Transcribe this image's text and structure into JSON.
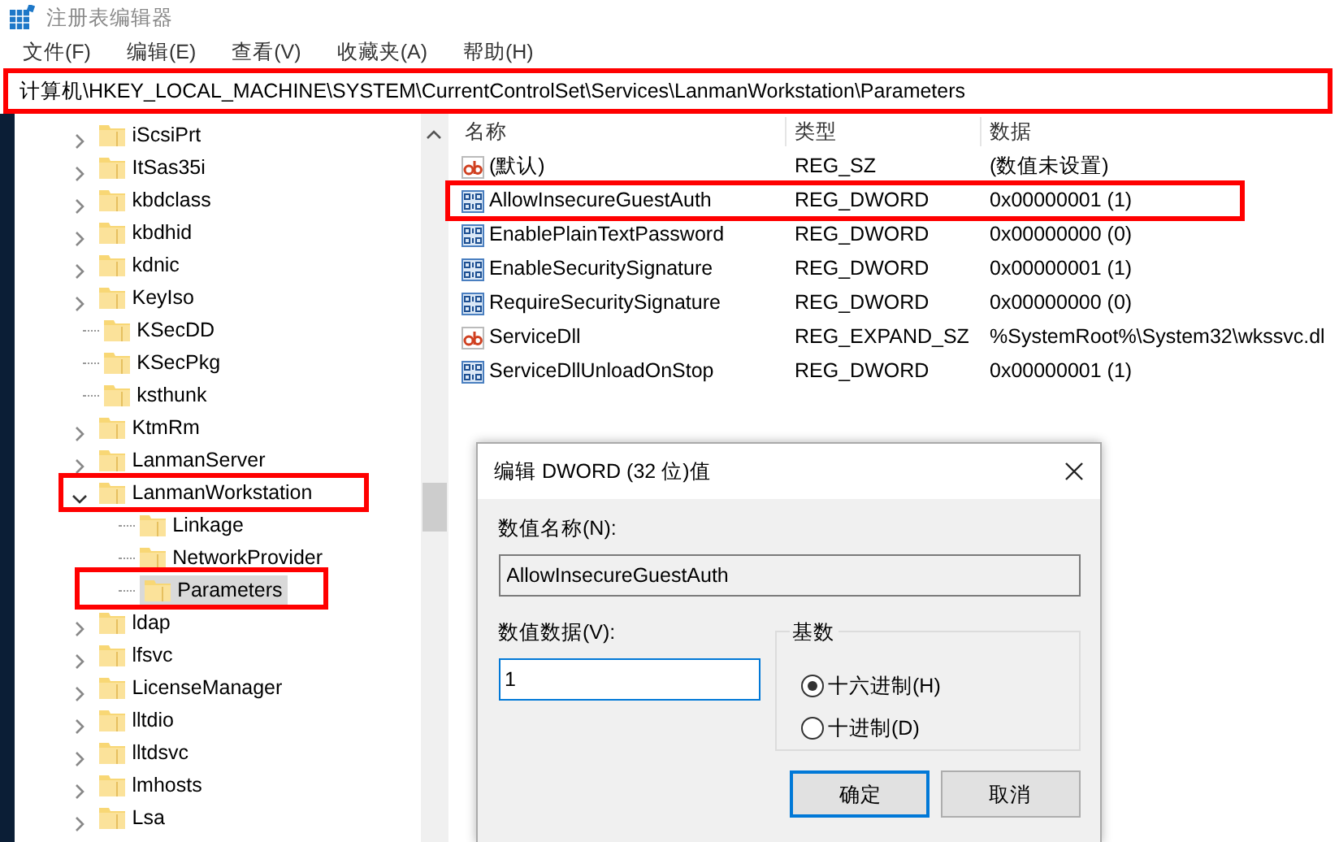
{
  "window": {
    "title": "注册表编辑器"
  },
  "menu": [
    "文件(F)",
    "编辑(E)",
    "查看(V)",
    "收藏夹(A)",
    "帮助(H)"
  ],
  "address_bar": {
    "path": "计算机\\HKEY_LOCAL_MACHINE\\SYSTEM\\CurrentControlSet\\Services\\LanmanWorkstation\\Parameters",
    "highlighted": true
  },
  "tree": [
    {
      "label": "iScsiPrt",
      "expanded": false,
      "selected": false,
      "highlighted": false
    },
    {
      "label": "ItSas35i",
      "expanded": false,
      "selected": false,
      "highlighted": false
    },
    {
      "label": "kbdclass",
      "expanded": false,
      "selected": false,
      "highlighted": false
    },
    {
      "label": "kbdhid",
      "expanded": false,
      "selected": false,
      "highlighted": false
    },
    {
      "label": "kdnic",
      "expanded": false,
      "selected": false,
      "highlighted": false
    },
    {
      "label": "KeyIso",
      "expanded": false,
      "selected": false,
      "highlighted": false
    },
    {
      "label": "KSecDD",
      "selected": false,
      "highlighted": false
    },
    {
      "label": "KSecPkg",
      "selected": false,
      "highlighted": false
    },
    {
      "label": "ksthunk",
      "selected": false,
      "highlighted": false
    },
    {
      "label": "KtmRm",
      "expanded": false,
      "selected": false,
      "highlighted": false
    },
    {
      "label": "LanmanServer",
      "expanded": false,
      "selected": false,
      "highlighted": false
    },
    {
      "label": "LanmanWorkstation",
      "expanded": true,
      "selected": false,
      "highlighted": true,
      "children": [
        {
          "label": "Linkage",
          "selected": false,
          "highlighted": false
        },
        {
          "label": "NetworkProvider",
          "selected": false,
          "highlighted": false
        },
        {
          "label": "Parameters",
          "selected": true,
          "highlighted": true
        }
      ]
    },
    {
      "label": "ldap",
      "expanded": false,
      "selected": false,
      "highlighted": false
    },
    {
      "label": "lfsvc",
      "expanded": false,
      "selected": false,
      "highlighted": false
    },
    {
      "label": "LicenseManager",
      "expanded": false,
      "selected": false,
      "highlighted": false
    },
    {
      "label": "lltdio",
      "expanded": false,
      "selected": false,
      "highlighted": false
    },
    {
      "label": "lltdsvc",
      "expanded": false,
      "selected": false,
      "highlighted": false
    },
    {
      "label": "lmhosts",
      "expanded": false,
      "selected": false,
      "highlighted": false
    },
    {
      "label": "Lsa",
      "expanded": false,
      "selected": false,
      "highlighted": false
    }
  ],
  "values_table": {
    "columns": [
      "名称",
      "类型",
      "数据"
    ],
    "rows": [
      {
        "kind": "string",
        "name": "(默认)",
        "type": "REG_SZ",
        "data": "(数值未设置)",
        "highlighted": false
      },
      {
        "kind": "binary",
        "name": "AllowInsecureGuestAuth",
        "type": "REG_DWORD",
        "data": "0x00000001 (1)",
        "highlighted": true
      },
      {
        "kind": "binary",
        "name": "EnablePlainTextPassword",
        "type": "REG_DWORD",
        "data": "0x00000000 (0)",
        "highlighted": false
      },
      {
        "kind": "binary",
        "name": "EnableSecuritySignature",
        "type": "REG_DWORD",
        "data": "0x00000001 (1)",
        "highlighted": false
      },
      {
        "kind": "binary",
        "name": "RequireSecuritySignature",
        "type": "REG_DWORD",
        "data": "0x00000000 (0)",
        "highlighted": false
      },
      {
        "kind": "string",
        "name": "ServiceDll",
        "type": "REG_EXPAND_SZ",
        "data": "%SystemRoot%\\System32\\wkssvc.dl",
        "highlighted": false
      },
      {
        "kind": "binary",
        "name": "ServiceDllUnloadOnStop",
        "type": "REG_DWORD",
        "data": "0x00000001 (1)",
        "highlighted": false
      }
    ]
  },
  "dialog": {
    "title": "编辑 DWORD (32 位)值",
    "name_label": "数值名称(N):",
    "name_value": "AllowInsecureGuestAuth",
    "data_label": "数值数据(V):",
    "data_value": "1",
    "base_group": "基数",
    "base_options": [
      {
        "label": "十六进制(H)",
        "selected": true
      },
      {
        "label": "十进制(D)",
        "selected": false
      }
    ],
    "buttons": [
      {
        "label": "确定",
        "default": true
      },
      {
        "label": "取消",
        "default": false
      }
    ]
  }
}
